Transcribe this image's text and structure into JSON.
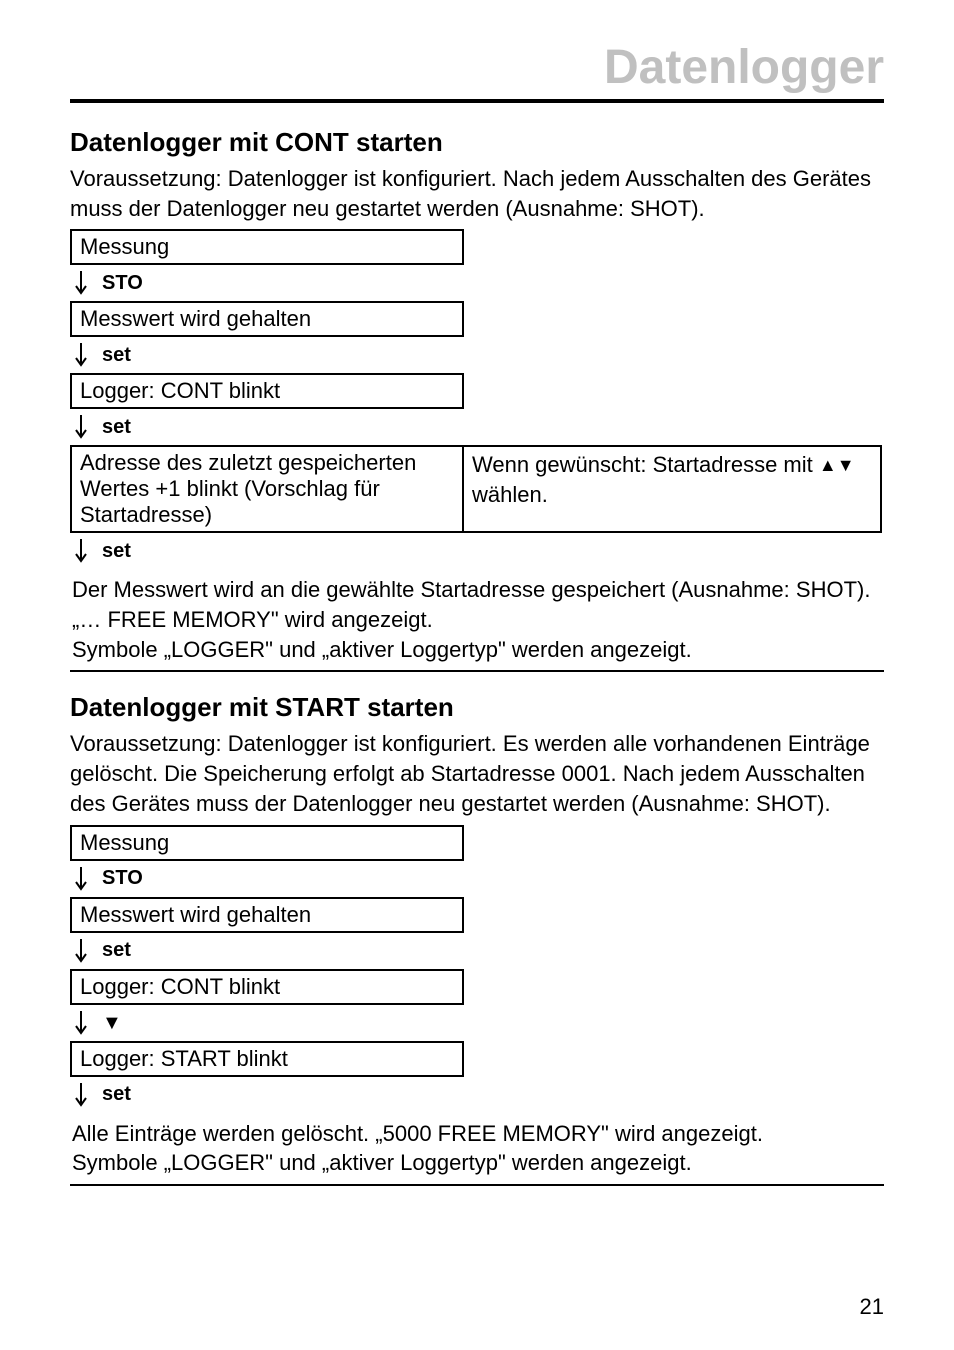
{
  "pageTitle": "Datenlogger",
  "sectionA": {
    "heading": "Datenlogger mit CONT starten",
    "intro": "Voraussetzung: Datenlogger ist konfiguriert. Nach jedem Ausschalten des Gerätes muss der Datenlogger neu gestartet werden (Ausnahme: SHOT).",
    "box1": "Messung",
    "step1": "STO",
    "box2": "Messwert wird gehalten",
    "step2": "set",
    "box3": "Logger: CONT blinkt",
    "step3": "set",
    "box4": "Adresse des zuletzt gespeicher­ten Wertes +1 blinkt (Vorschlag für Startadresse)",
    "side4_pre": "Wenn gewünscht: Startadresse mit ",
    "side4_post": " wählen.",
    "step4": "set",
    "result": "Der Messwert wird an die gewählte Startadresse gespeichert (Ausnahme: SHOT). „… FREE MEMORY\" wird angezeigt.\nSymbole  „LOGGER\" und „aktiver Loggertyp\" werden angezeigt."
  },
  "sectionB": {
    "heading": "Datenlogger mit START starten",
    "intro": "Voraussetzung: Datenlogger ist konfiguriert. Es werden alle vorhandenen Einträge gelöscht. Die Speicherung erfolgt ab Startadresse 0001. Nach jedem Ausschalten des Gerätes muss der Datenlogger neu gestartet werden (Ausnahme: SHOT).",
    "box1": "Messung",
    "step1": "STO",
    "box2": "Messwert wird gehalten",
    "step2": "set",
    "box3": "Logger: CONT blinkt",
    "box4": "Logger: START blinkt",
    "step4": "set",
    "result": "Alle Einträge werden gelöscht. „5000 FREE MEMORY\" wird angezeigt.\nSymbole  „LOGGER\" und „aktiver Loggertyp\" werden angezeigt."
  },
  "pageNumber": "21"
}
